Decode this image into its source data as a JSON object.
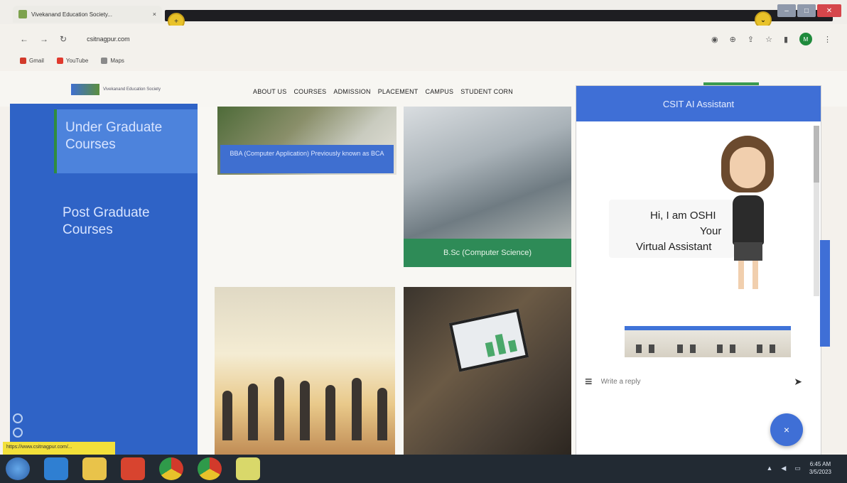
{
  "browser": {
    "tab_title": "Vivekanand Education Society...",
    "address": "csitnagpur.com",
    "bookmarks": [
      "Gmail",
      "YouTube",
      "Maps"
    ]
  },
  "site": {
    "logo_text": "Vivekanand Education Society",
    "nav": [
      "ABOUT US",
      "COURSES",
      "ADMISSION",
      "PLACEMENT",
      "CAMPUS",
      "STUDENT CORN"
    ]
  },
  "sidebar": {
    "items": [
      {
        "label": "Under Graduate Courses"
      },
      {
        "label": "Post Graduate Courses"
      }
    ],
    "hover_url": "https://www.csitnagpur.com/..."
  },
  "cards": [
    {
      "label": "BBA (Computer Application) Previously known as BCA"
    },
    {
      "label": "B.Sc (Computer Science)"
    }
  ],
  "chat": {
    "header": "CSIT AI Assistant",
    "greeting": [
      "Hi, I am OSHI",
      "Your",
      "Virtual Assistant"
    ],
    "reply_placeholder": "Write a reply",
    "fab_label": "×"
  },
  "taskbar": {
    "time": "6:45 AM",
    "date": "3/5/2023"
  }
}
